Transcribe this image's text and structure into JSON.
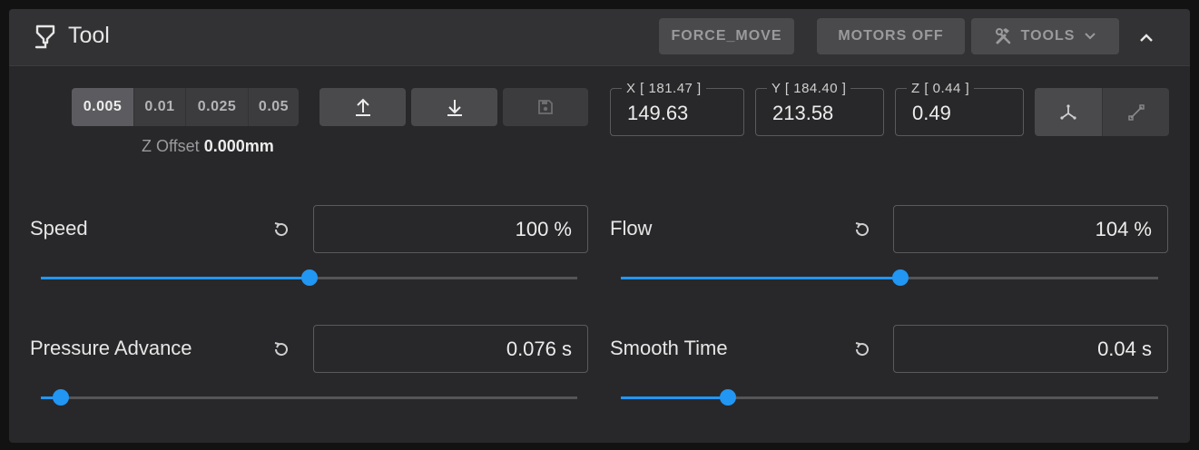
{
  "header": {
    "title": "Tool",
    "title_icon": "printer-nozzle-icon",
    "buttons": {
      "force_move": "FORCE_MOVE",
      "motors_off": "MOTORS OFF",
      "tools": "TOOLS"
    }
  },
  "zoffset": {
    "steps": [
      "0.005",
      "0.01",
      "0.025",
      "0.05"
    ],
    "active_step": "0.005",
    "label": "Z Offset",
    "value": "0.000mm"
  },
  "position": {
    "x": {
      "label": "X [ 181.47 ]",
      "value": "149.63"
    },
    "y": {
      "label": "Y [ 184.40 ]",
      "value": "213.58"
    },
    "z": {
      "label": "Z [ 0.44 ]",
      "value": "0.49"
    }
  },
  "sliders": {
    "speed": {
      "label": "Speed",
      "display": "100 %",
      "fraction": 0.5
    },
    "flow": {
      "label": "Flow",
      "display": "104 %",
      "fraction": 0.52
    },
    "pressure_advance": {
      "label": "Pressure Advance",
      "display": "0.076 s",
      "fraction": 0.038
    },
    "smooth_time": {
      "label": "Smooth Time",
      "display": "0.04 s",
      "fraction": 0.2
    }
  },
  "colors": {
    "accent": "#2196f3",
    "card": "#28282a",
    "header": "#323234"
  }
}
